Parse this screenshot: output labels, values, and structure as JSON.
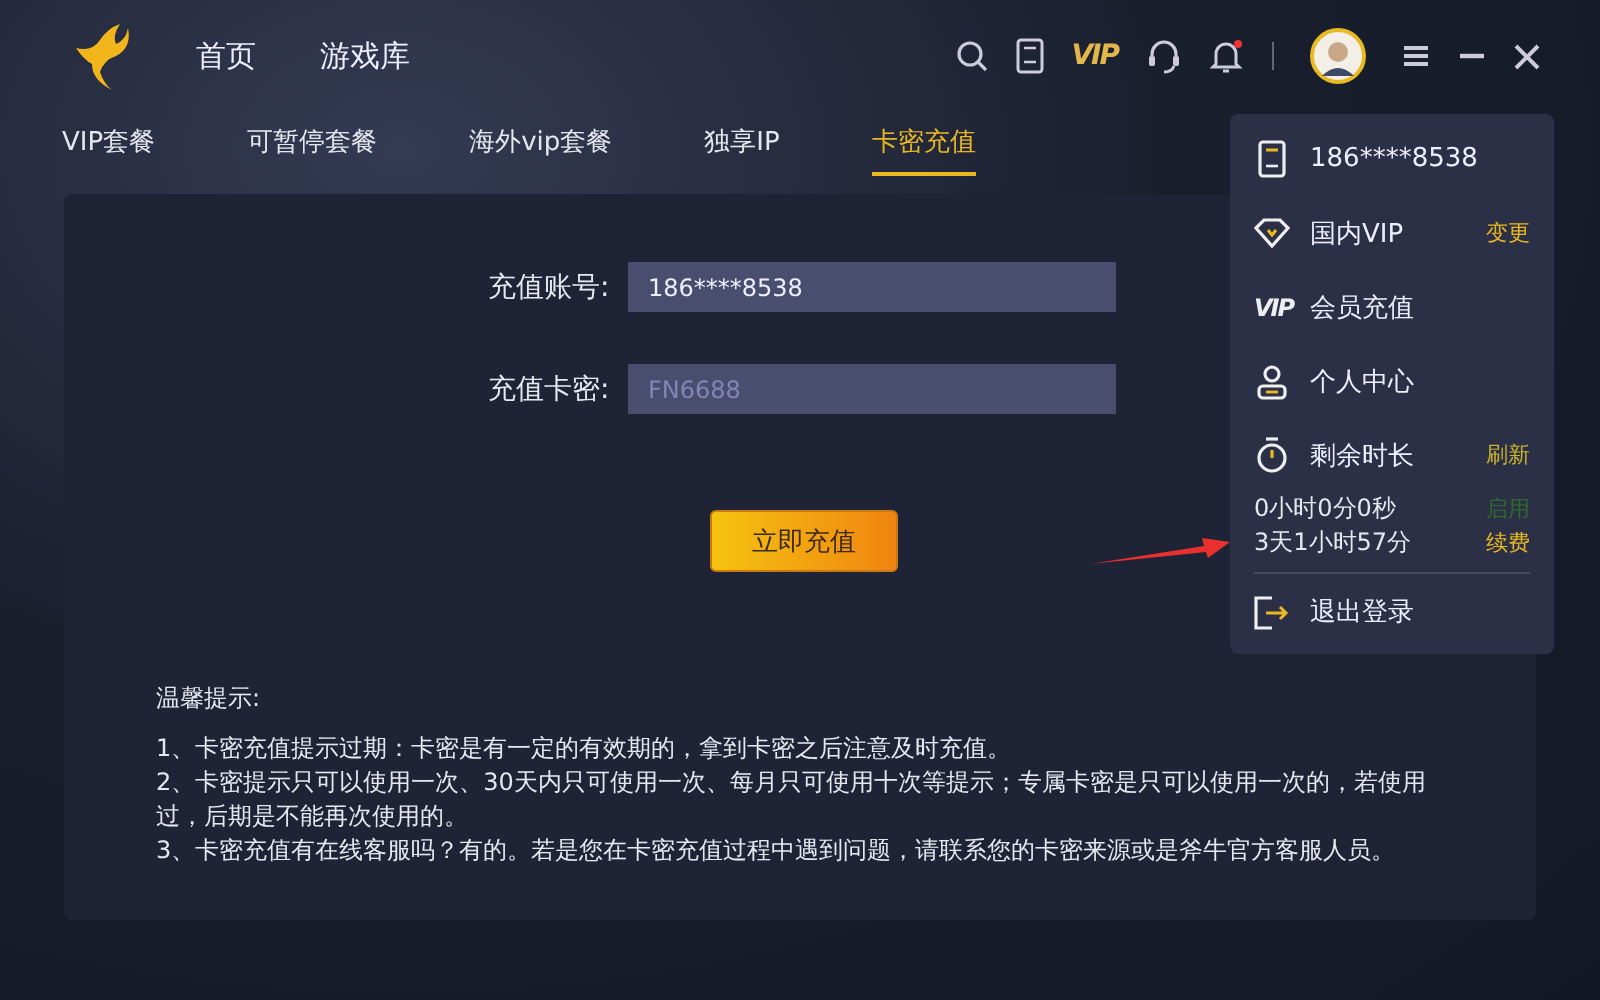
{
  "nav": [
    {
      "label": "首页",
      "selected": false
    },
    {
      "label": "游戏库",
      "selected": false
    }
  ],
  "toolbar": {
    "vip_label": "VIP"
  },
  "tabs": [
    {
      "label": "VIP套餐",
      "selected": false
    },
    {
      "label": "可暂停套餐",
      "selected": false
    },
    {
      "label": "海外vip套餐",
      "selected": false
    },
    {
      "label": "独享IP",
      "selected": false
    },
    {
      "label": "卡密充值",
      "selected": true
    }
  ],
  "form": {
    "account_label": "充值账号:",
    "account_value": "186****8538",
    "card_label": "充值卡密:",
    "card_placeholder": "FN6688",
    "submit": "立即充值"
  },
  "notes": {
    "title": "温馨提示:",
    "lines": [
      "1、卡密充值提示过期：卡密是有一定的有效期的，拿到卡密之后注意及时充值。",
      "2、卡密提示只可以使用一次、30天内只可使用一次、每月只可使用十次等提示；专属卡密是只可以使用一次的，若使用过，后期是不能再次使用的。",
      "3、卡密充值有在线客服吗？有的。若是您在卡密充值过程中遇到问题，请联系您的卡密来源或是斧牛官方客服人员。"
    ]
  },
  "user_menu": {
    "items": [
      {
        "kind": "phone",
        "label": "186****8538"
      },
      {
        "kind": "vip",
        "label": "国内VIP",
        "action": "变更",
        "color": "#e8b923"
      },
      {
        "kind": "recharge",
        "label": "会员充值",
        "icon_text": "VIP"
      },
      {
        "kind": "profile",
        "label": "个人中心"
      },
      {
        "kind": "timer",
        "label": "剩余时长",
        "action": "刷新",
        "color": "#c8b42a"
      },
      {
        "kind": "time",
        "label": "0小时0分0秒",
        "action": "启用",
        "color": "#2e6b2e"
      },
      {
        "kind": "time",
        "label": "3天1小时57分",
        "action": "续费",
        "color": "#e8b923"
      },
      {
        "kind": "logout",
        "label": "退出登录"
      }
    ]
  }
}
